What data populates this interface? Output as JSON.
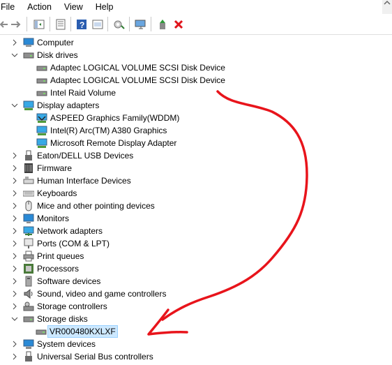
{
  "menu": {
    "file": "File",
    "action": "Action",
    "view": "View",
    "help": "Help"
  },
  "toolbar": {
    "buttons": [
      "back-icon",
      "forward-icon",
      "show-hide-tree-icon",
      "properties-icon",
      "help-icon",
      "show-hidden-icon",
      "scan-hardware-icon",
      "monitor-icon",
      "update-driver-icon",
      "uninstall-icon"
    ]
  },
  "tree": {
    "computer": "Computer",
    "disk_drives": "Disk drives",
    "disk1": "Adaptec LOGICAL VOLUME SCSI Disk Device",
    "disk2": "Adaptec LOGICAL VOLUME SCSI Disk Device",
    "disk3": "Intel Raid Volume",
    "display_adapters": "Display adapters",
    "gpu1": "ASPEED Graphics Family(WDDM)",
    "gpu2": "Intel(R) Arc(TM) A380 Graphics",
    "gpu3": "Microsoft Remote Display Adapter",
    "eaton": "Eaton/DELL USB Devices",
    "firmware": "Firmware",
    "hid": "Human Interface Devices",
    "keyboards": "Keyboards",
    "mice": "Mice and other pointing devices",
    "monitors": "Monitors",
    "network": "Network adapters",
    "ports": "Ports (COM & LPT)",
    "printq": "Print queues",
    "processors": "Processors",
    "software": "Software devices",
    "sound": "Sound, video and game controllers",
    "storage_ctrl": "Storage controllers",
    "storage_disks": "Storage disks",
    "vr_disk": "VR000480KXLXF",
    "system_devices": "System devices",
    "usb": "Universal Serial Bus controllers"
  },
  "colors": {
    "annotation": "#e8141b",
    "selection": "#cce8ff"
  }
}
